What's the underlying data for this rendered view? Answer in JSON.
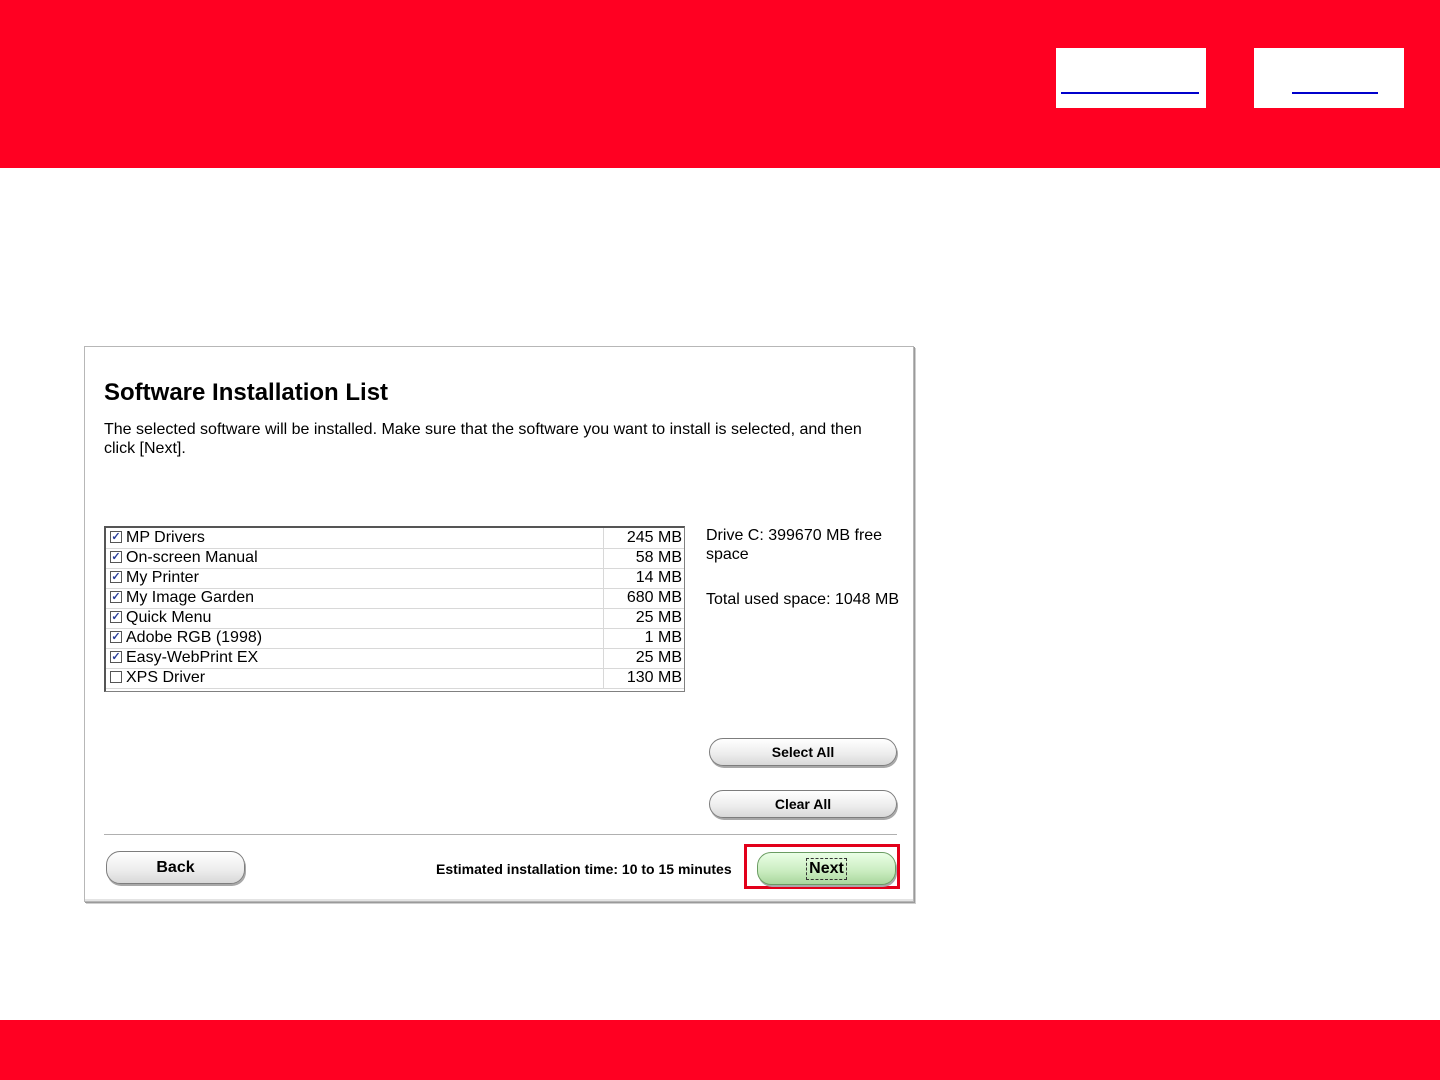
{
  "dialog": {
    "title": "Software Installation List",
    "description": "The selected software will be installed. Make sure that the software you want to install is selected, and then click [Next].",
    "software": [
      {
        "name": "MP Drivers",
        "size": "245 MB",
        "checked": true
      },
      {
        "name": "On-screen Manual",
        "size": "58 MB",
        "checked": true
      },
      {
        "name": "My Printer",
        "size": "14 MB",
        "checked": true
      },
      {
        "name": "My Image Garden",
        "size": "680 MB",
        "checked": true
      },
      {
        "name": "Quick Menu",
        "size": "25 MB",
        "checked": true
      },
      {
        "name": "Adobe RGB (1998)",
        "size": "1 MB",
        "checked": true
      },
      {
        "name": "Easy-WebPrint EX",
        "size": "25 MB",
        "checked": true
      },
      {
        "name": "XPS Driver",
        "size": "130 MB",
        "checked": false
      }
    ],
    "drive_space": "Drive C: 399670 MB free space",
    "total_used": "Total used space: 1048 MB",
    "select_all_label": "Select All",
    "clear_all_label": "Clear All",
    "back_label": "Back",
    "estimated_time": "Estimated installation time: 10 to 15 minutes",
    "next_label": "Next"
  },
  "colors": {
    "brand_red": "#ff0022",
    "highlight_red": "#e2001a",
    "next_green": "#c9ecbf",
    "check_blue": "#2a3f9a"
  }
}
